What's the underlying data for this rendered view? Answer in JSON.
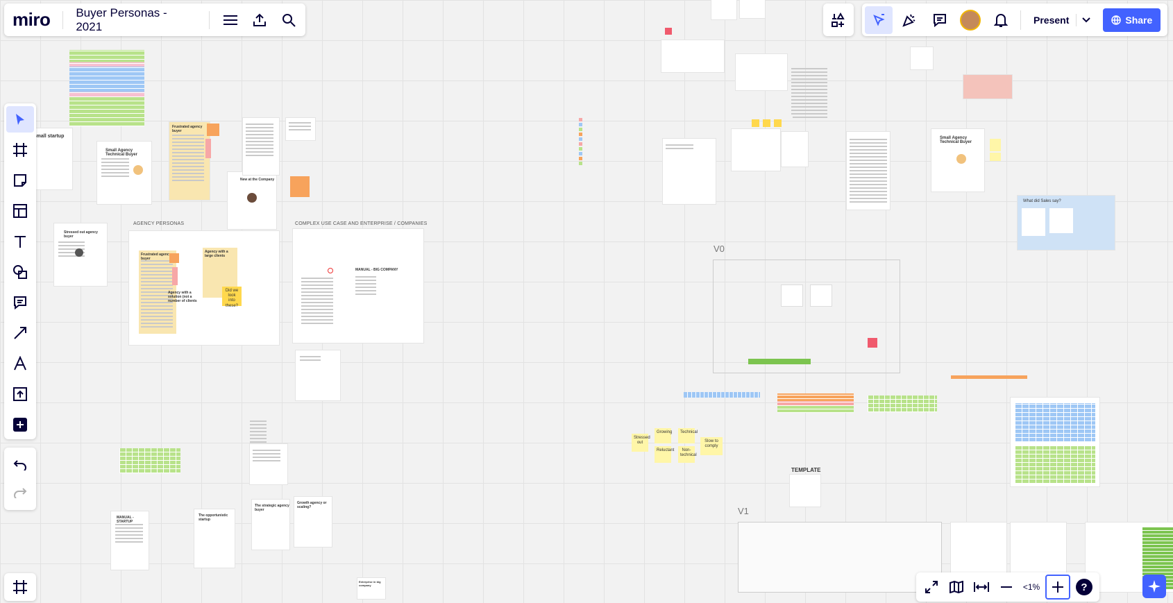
{
  "app": {
    "logo": "miro",
    "board_title": "Buyer Personas - 2021"
  },
  "topbar": {
    "present_label": "Present",
    "share_label": "Share"
  },
  "zoom": {
    "level": "<1%"
  },
  "canvas": {
    "labels": {
      "agency_personas": "AGENCY PERSONAS",
      "complex_use_case": "COMPLEX USE CASE AND ENTERPRISE / COMPANIES",
      "v0": "V0",
      "v1": "V1",
      "template": "TEMPLATE",
      "what_sales_say": "What did Sales say?",
      "small_agency_buyer": "Small Agency Technical Buyer",
      "small_agency_buyer_right": "Small Agency Technical Buyer",
      "frustrated_agency_buyer": "Frustrated agency buyer",
      "frustrated_agency_buyer_2": "Frustrated agency buyer",
      "agency_large_clients": "Agency with a large clients",
      "stressed_out_buyer": "Stressed out agency buyer",
      "new_at_company": "New at the Company",
      "manual_big_company": "MANUAL - BIG COMPANY",
      "manual_startup": "MANUAL - STARTUP",
      "opportunistic_startup": "The opportunistic startup",
      "strategic_buyer": "The strategic agency buyer",
      "growth_agency": "Growth agency or scaling?",
      "small_startup": "Small startup",
      "did_we_look": "Did we look into these?",
      "stressed_out": "Stressed out",
      "growing": "Growing",
      "technical": "Technical",
      "reluctant": "Reluctant",
      "non_technical": "Non-technical",
      "slow_to_comply": "Slow to comply",
      "agency_with_a_solution": "Agency with a solution (not a number of clients",
      "enterprise_big_company": "Enterprise in big company"
    }
  },
  "colors": {
    "accent": "#4262ff",
    "sticky_yellow": "#fff6a8",
    "sticky_orange": "#f7a35c",
    "sticky_pink": "#f7a7a7",
    "green": "#b8e28a",
    "blue": "#9ec7f5"
  }
}
